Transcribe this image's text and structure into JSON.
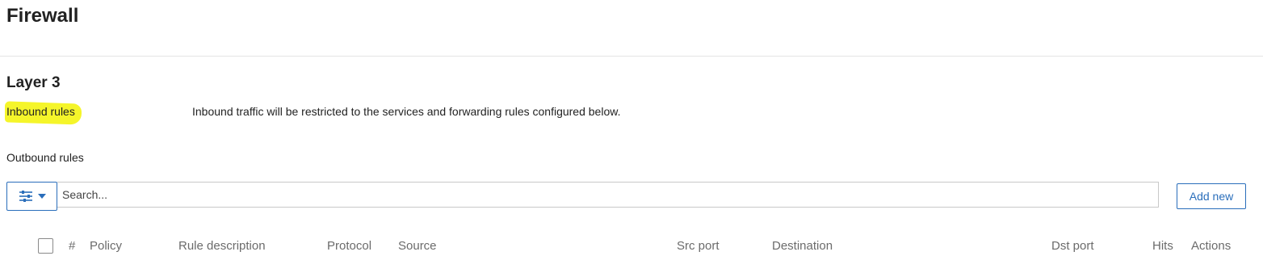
{
  "page": {
    "title": "Firewall"
  },
  "layer3": {
    "title": "Layer 3",
    "inbound_label": "Inbound rules",
    "inbound_description": "Inbound traffic will be restricted to the services and forwarding rules configured below.",
    "outbound_label": "Outbound rules"
  },
  "toolbar": {
    "filter_icon": "sliders-icon",
    "filter_dropdown_icon": "caret-down-icon",
    "search_placeholder": "Search...",
    "search_value": "",
    "add_new_label": "Add new"
  },
  "table": {
    "columns": [
      "#",
      "Policy",
      "Rule description",
      "Protocol",
      "Source",
      "Src port",
      "Destination",
      "Dst port",
      "Hits",
      "Actions"
    ]
  },
  "colors": {
    "accent": "#2a6ebb",
    "highlight": "#f5f52a",
    "header_text": "#6b6b6b"
  }
}
